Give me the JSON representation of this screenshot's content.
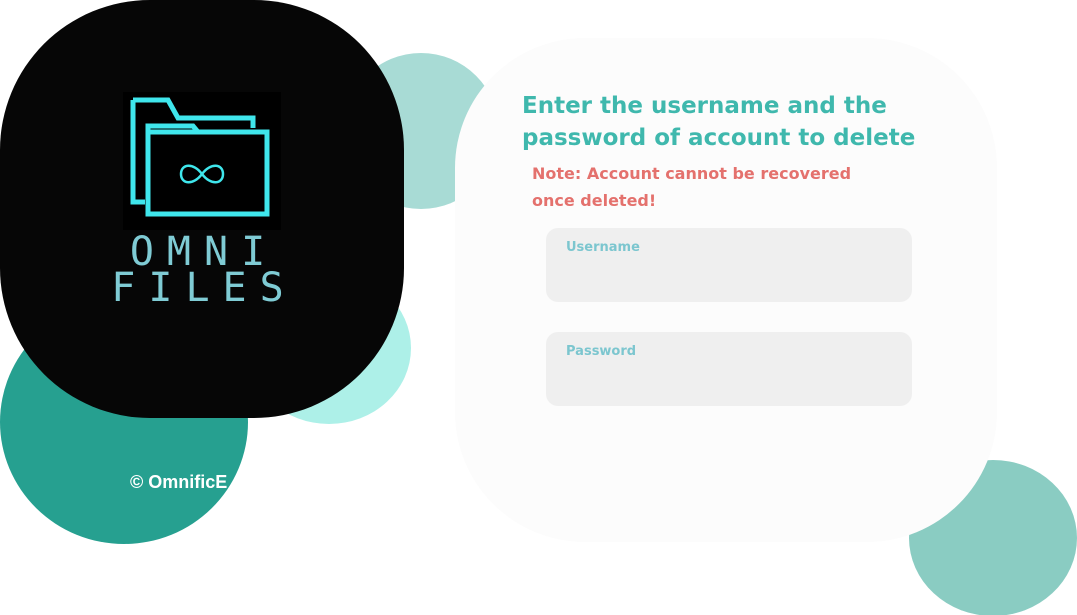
{
  "logo": {
    "line1": "OMNI",
    "line2": "FILES",
    "icon": "folder-infinity-icon",
    "icon_color": "#3fe6ec",
    "text_color": "#7fcbd4",
    "background": "#060606"
  },
  "footer": {
    "copyright": "© OmnificE"
  },
  "form": {
    "heading": "Enter the username and the password of account to delete",
    "note": "Note: Account cannot be recovered once deleted!",
    "username_label": "Username",
    "username_value": "",
    "password_label": "Password",
    "password_value": ""
  },
  "colors": {
    "heading": "#3fb8ad",
    "note": "#e4716d",
    "field_label": "#7cc6cf",
    "field_bg": "#efefef",
    "panel_bg": "#fcfcfc",
    "circle_teal": "#26a090",
    "circle_mint": "#adf0e8",
    "circle_light": "#a8dbd5",
    "circle_sage": "#8accc2"
  }
}
